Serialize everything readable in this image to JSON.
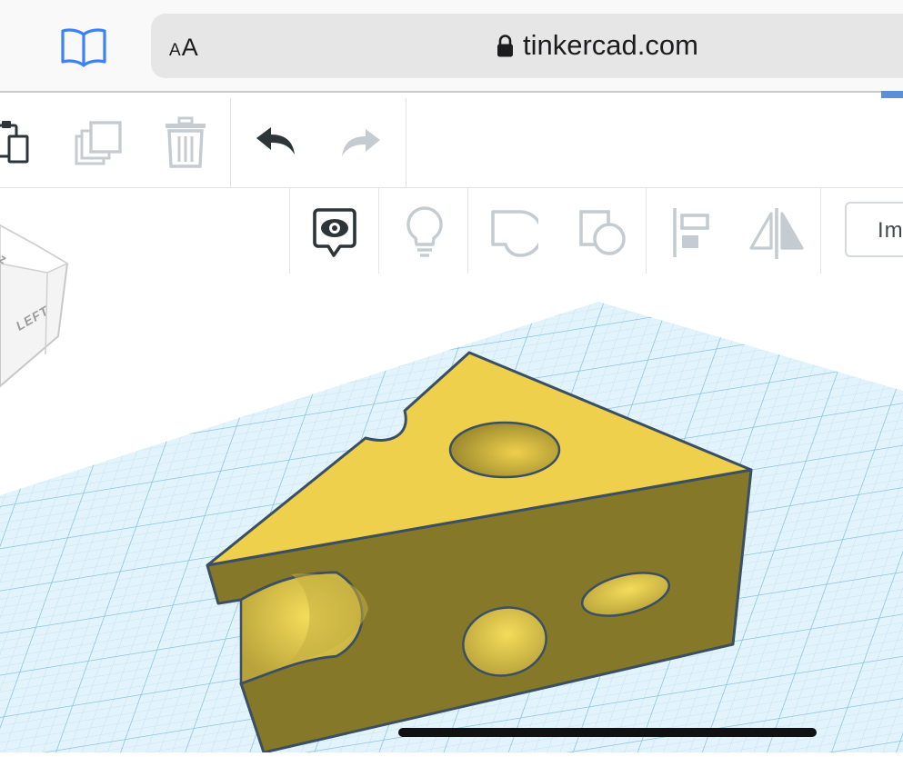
{
  "browser": {
    "reader_label_small": "A",
    "reader_label_big": "A",
    "domain": "tinkercad.com",
    "icons": {
      "bookmarks": "book-icon",
      "lock": "lock-icon"
    }
  },
  "toolbar": {
    "edit_icons": [
      "paste-icon",
      "duplicate-icon",
      "delete-icon",
      "undo-icon",
      "redo-icon"
    ],
    "view_icons": [
      "notes-icon",
      "lightbulb-icon",
      "shape-solid-icon",
      "shape-hole-icon",
      "align-icon",
      "mirror-icon"
    ],
    "import_label": "Im"
  },
  "viewcube": {
    "face_label": "LEFT"
  },
  "colors": {
    "cheese_top": "#efd04c",
    "cheese_side": "#857828",
    "outline": "#3a4f63",
    "grid_bg": "#dff1fa",
    "grid_line": "#aed8ec",
    "toolbar_icon_active": "#2d3539",
    "toolbar_icon_disabled": "#bcc3c8"
  }
}
